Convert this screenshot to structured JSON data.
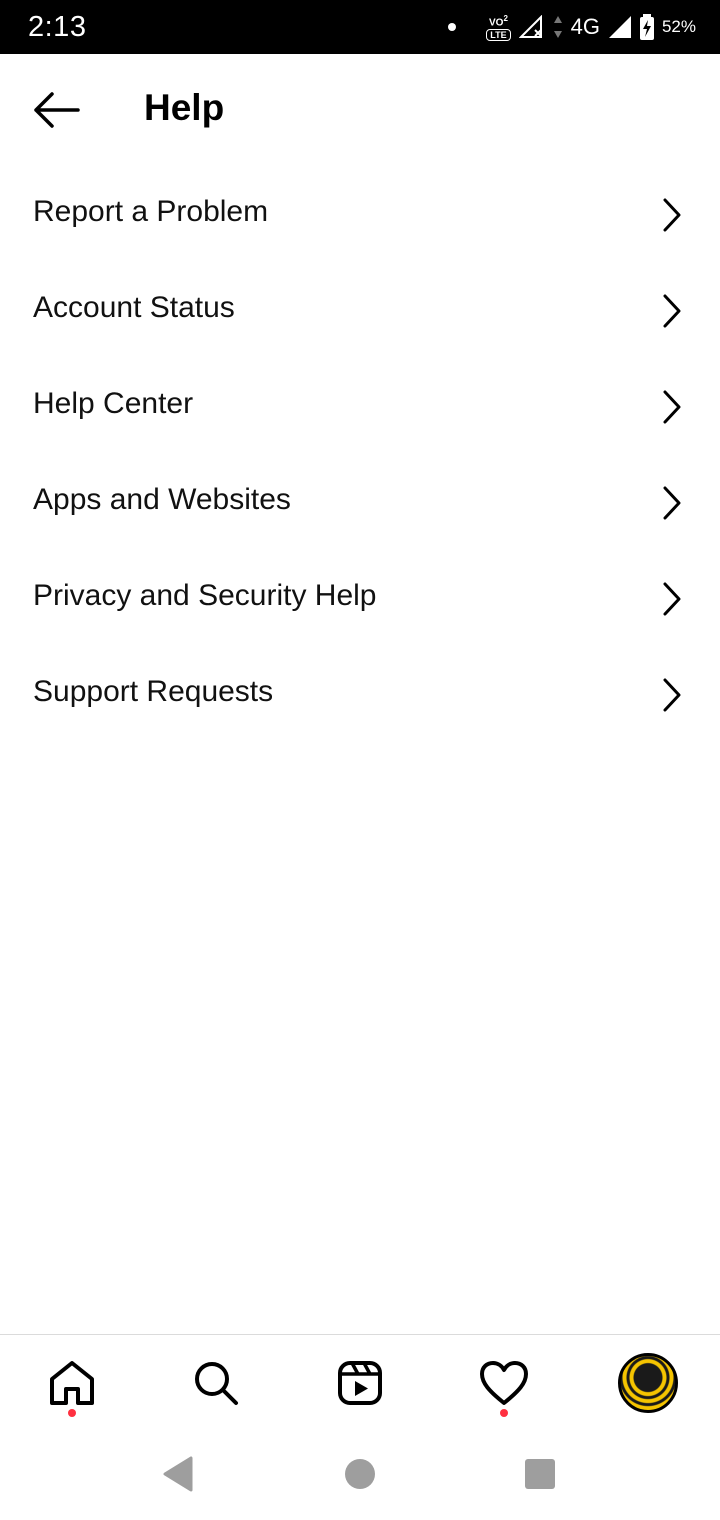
{
  "status_bar": {
    "time": "2:13",
    "volte_top": "VO",
    "volte_sub": "2",
    "volte_lte": "LTE",
    "network": "4G",
    "battery": "52%"
  },
  "header": {
    "title": "Help",
    "back_icon": "arrow-left-icon"
  },
  "menu": {
    "items": [
      {
        "label": "Report a Problem"
      },
      {
        "label": "Account Status"
      },
      {
        "label": "Help Center"
      },
      {
        "label": "Apps and Websites"
      },
      {
        "label": "Privacy and Security Help"
      },
      {
        "label": "Support Requests"
      }
    ],
    "chevron_icon": "chevron-right-icon"
  },
  "bottom_nav": {
    "items": [
      {
        "icon": "home-icon",
        "has_dot": true
      },
      {
        "icon": "search-icon",
        "has_dot": false
      },
      {
        "icon": "reels-icon",
        "has_dot": false
      },
      {
        "icon": "heart-icon",
        "has_dot": true
      },
      {
        "icon": "profile-avatar",
        "has_dot": false
      }
    ],
    "notification_color": "#ff3040"
  },
  "system_nav": {
    "buttons": [
      "back-triangle-icon",
      "home-circle-icon",
      "recents-square-icon"
    ],
    "color": "#9e9e9e"
  }
}
